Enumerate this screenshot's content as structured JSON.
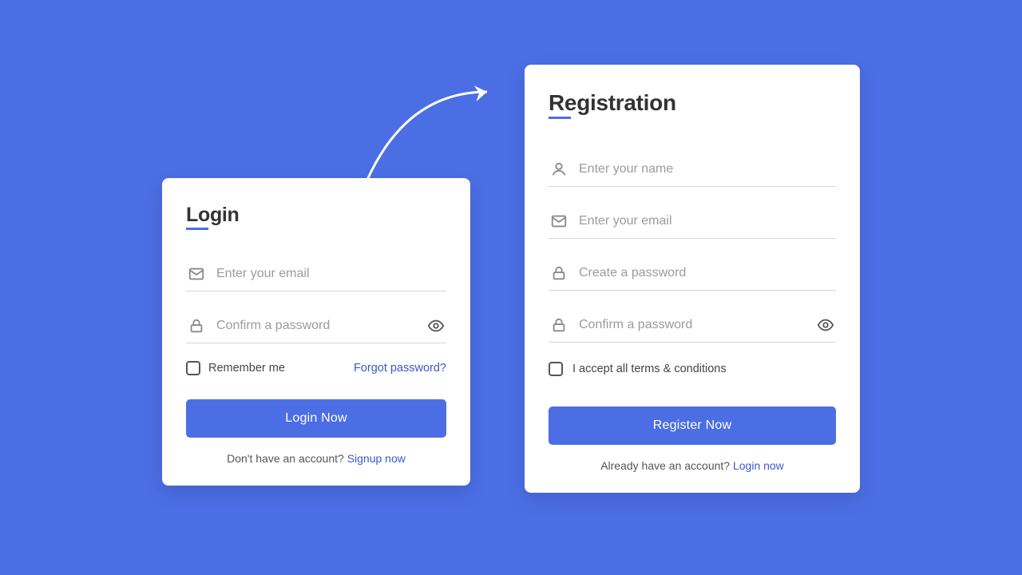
{
  "login": {
    "title": "Login",
    "email_placeholder": "Enter your email",
    "password_placeholder": "Confirm a password",
    "remember_label": "Remember me",
    "forgot_label": "Forgot password?",
    "button_label": "Login Now",
    "footer_text": "Don't have an account? ",
    "footer_link": "Signup now"
  },
  "register": {
    "title": "Registration",
    "name_placeholder": "Enter your name",
    "email_placeholder": "Enter your email",
    "password_placeholder": "Create a password",
    "confirm_placeholder": "Confirm a password",
    "terms_label": "I accept all terms & conditions",
    "button_label": "Register Now",
    "footer_text": "Already  have an account? ",
    "footer_link": "Login now"
  }
}
